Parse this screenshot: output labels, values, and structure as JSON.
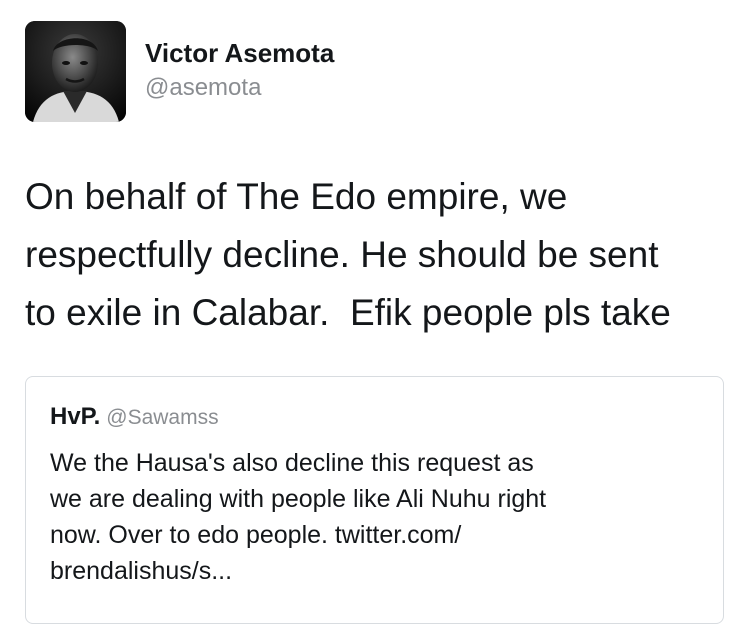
{
  "tweet": {
    "author": {
      "display_name": "Victor Asemota",
      "handle": "@asemota",
      "avatar_icon": "profile-photo"
    },
    "text": "On behalf of The Edo empire, we\nrespectfully decline. He should be sent\nto exile in Calabar.  Efik people pls take",
    "quoted_tweet": {
      "display_name": "HvP.",
      "handle": "@Sawamss",
      "text": "We the Hausa's also decline this request as\nwe are dealing with people like Ali Nuhu right\nnow. Over to edo people. twitter.com/\nbrendalishus/s..."
    }
  },
  "colors": {
    "text_primary": "#14171a",
    "text_secondary": "#8a8d91",
    "card_border": "#d8dce0"
  }
}
